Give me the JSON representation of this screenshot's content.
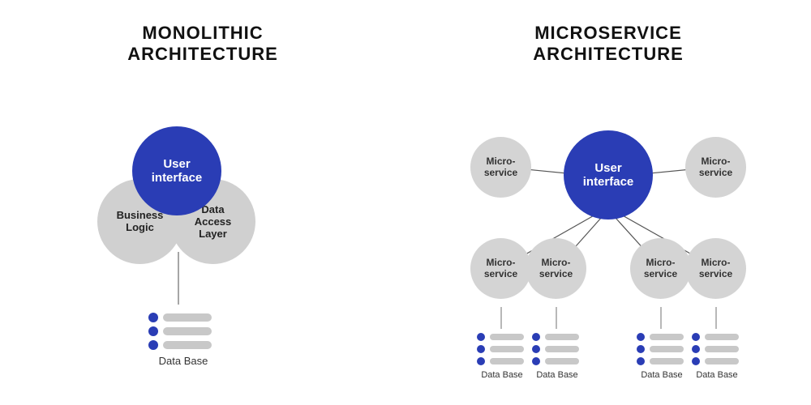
{
  "monolithic": {
    "title": "MONOLITHIC",
    "title2": "ARCHITECTURE",
    "ui_label": "User\ninterface",
    "business_label": "Business\nLogic",
    "dal_label": "Data\nAccess\nLayer",
    "db_label": "Data Base"
  },
  "microservice": {
    "title": "MICROSERVICE",
    "title2": "ARCHITECTURE",
    "ui_label": "User\ninterface",
    "micro_label": "Micro-\nservice",
    "db_label": "Data Base"
  }
}
